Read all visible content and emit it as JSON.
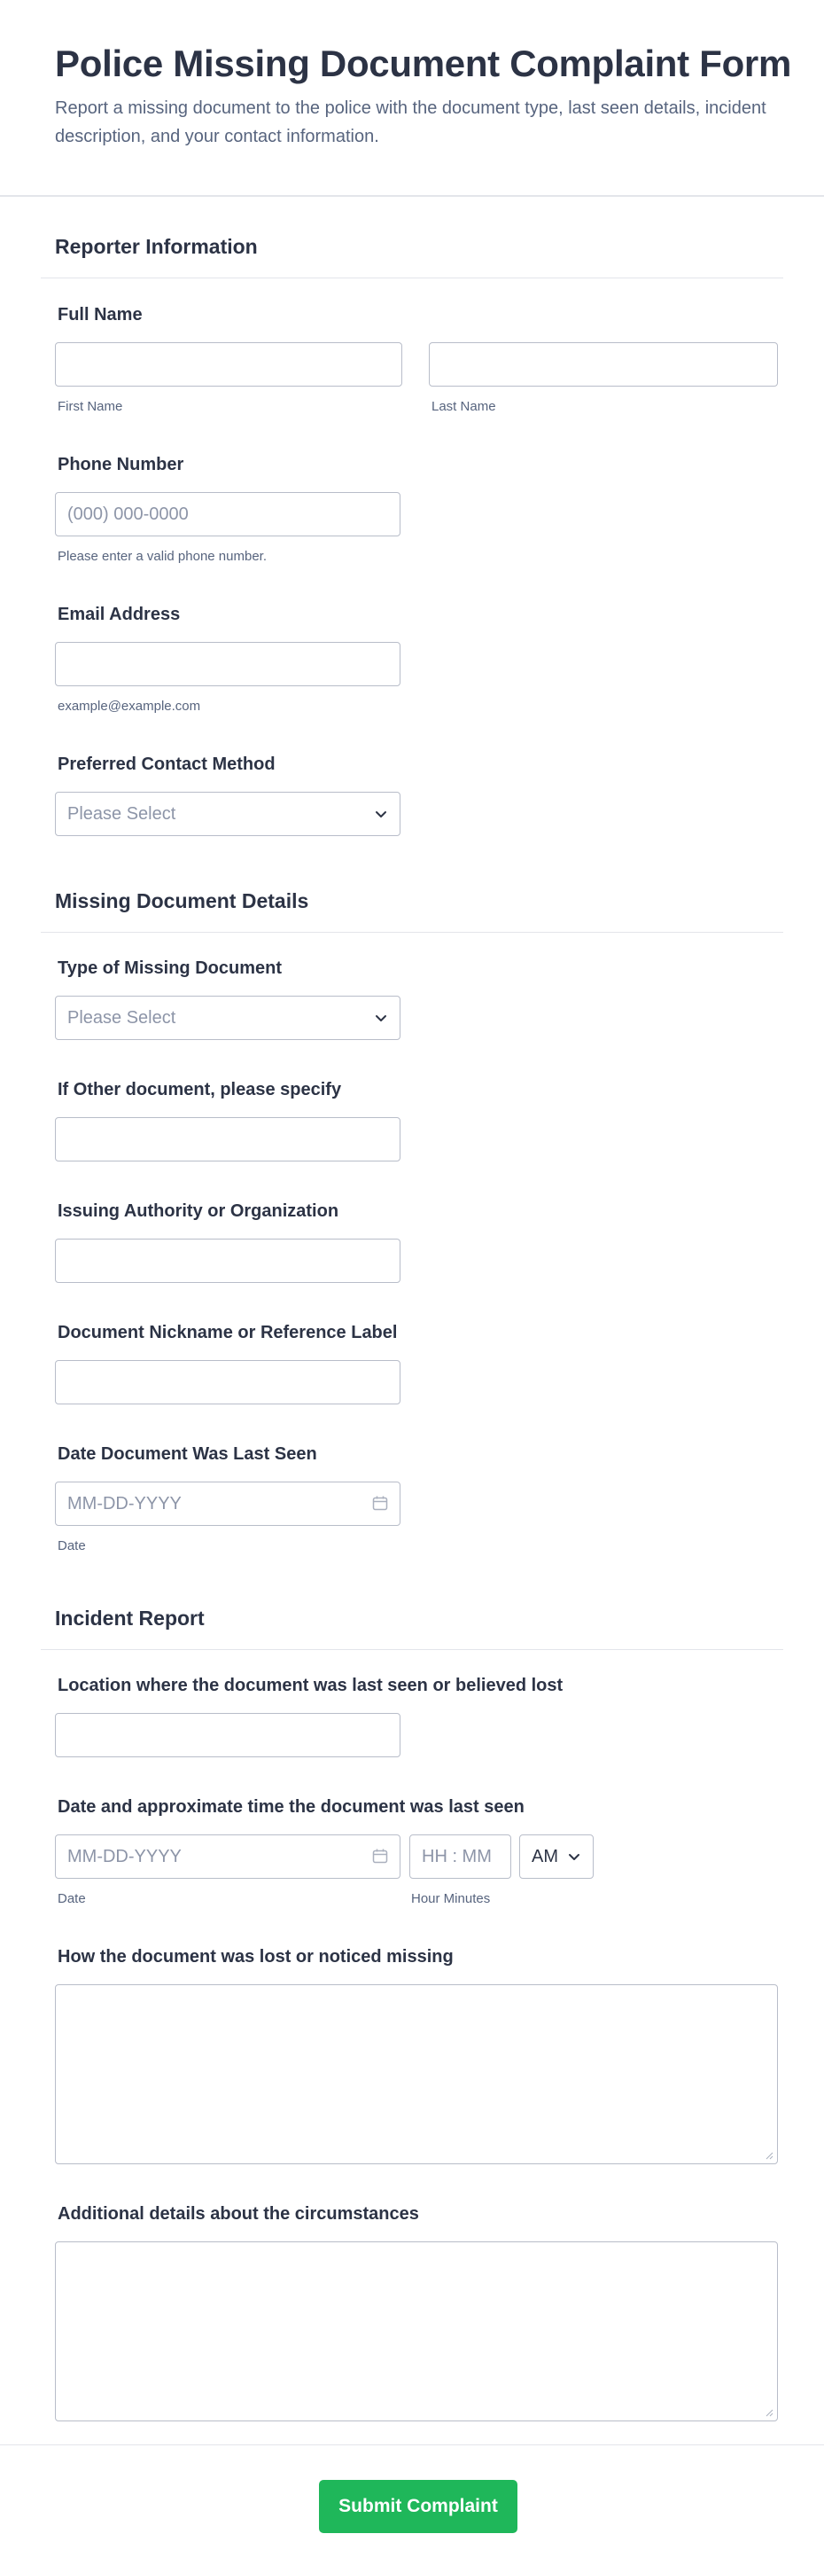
{
  "form": {
    "title": "Police Missing Document Complaint Form",
    "description": "Report a missing document to the police with the document type, last seen details, incident description, and your contact information."
  },
  "sections": {
    "reporter": "Reporter Information",
    "document": "Missing Document Details",
    "incident": "Incident Report"
  },
  "fields": {
    "full_name": {
      "label": "Full Name",
      "first_sublabel": "First Name",
      "last_sublabel": "Last Name",
      "first_value": "",
      "last_value": ""
    },
    "phone": {
      "label": "Phone Number",
      "placeholder": "(000) 000-0000",
      "sublabel": "Please enter a valid phone number."
    },
    "email": {
      "label": "Email Address",
      "sublabel": "example@example.com"
    },
    "contact_method": {
      "label": "Preferred Contact Method",
      "selected": "Please Select"
    },
    "doc_type": {
      "label": "Type of Missing Document",
      "selected": "Please Select"
    },
    "other_doc": {
      "label": "If Other document, please specify"
    },
    "issuer": {
      "label": "Issuing Authority or Organization"
    },
    "nickname": {
      "label": "Document Nickname or Reference Label"
    },
    "last_seen_date": {
      "label": "Date Document Was Last Seen",
      "placeholder": "MM-DD-YYYY",
      "sublabel": "Date"
    },
    "location": {
      "label": "Location where the document was last seen or believed lost"
    },
    "last_seen_datetime": {
      "label": "Date and approximate time the document was last seen",
      "date_placeholder": "MM-DD-YYYY",
      "time_placeholder": "HH : MM",
      "ampm": "AM",
      "date_sublabel": "Date",
      "time_sublabel": "Hour Minutes"
    },
    "how_lost": {
      "label": "How the document was lost or noticed missing"
    },
    "additional": {
      "label": "Additional details about the circumstances"
    }
  },
  "submit_label": "Submit Complaint",
  "icons": {
    "dropdown": "chevron-down-icon",
    "calendar": "calendar-icon",
    "resize": "resize-handle-icon"
  },
  "colors": {
    "submit": "#1fb75a",
    "text": "#2c3345",
    "muted": "#57647e",
    "border": "#b8bdc9"
  }
}
